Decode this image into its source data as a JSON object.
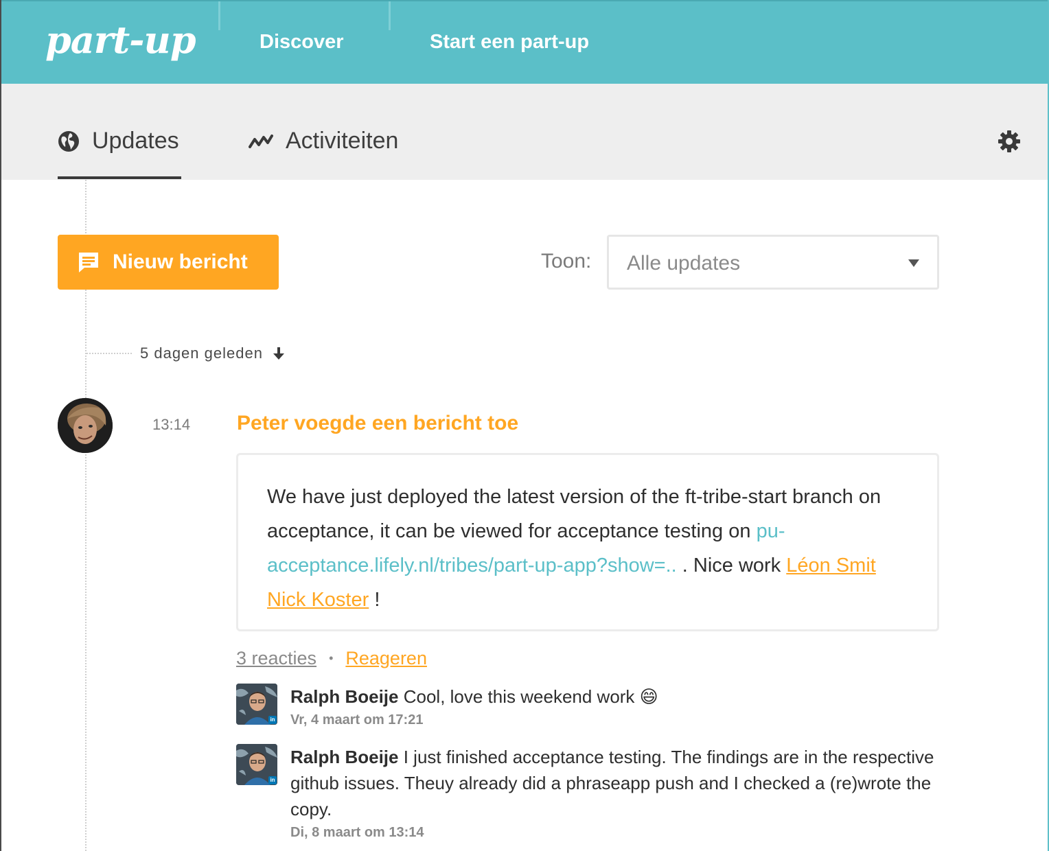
{
  "navbar": {
    "logo": "part-up",
    "links": [
      "Discover",
      "Start een part-up"
    ],
    "background": "#5bbfc8"
  },
  "tabs": {
    "updates": "Updates",
    "activities": "Activiteiten",
    "icons": {
      "updates": "globe-icon",
      "activities": "activity-icon",
      "settings": "gear-icon"
    }
  },
  "toolbar": {
    "new_message": "Nieuw bericht",
    "filter_label": "Toon:",
    "filter_value": "Alle updates",
    "accent": "#ffa622"
  },
  "timeline": {
    "date_label": "5 dagen geleden"
  },
  "post": {
    "time": "13:14",
    "title": "Peter voegde een bericht toe",
    "text_1": "We have just deployed the latest version of the ft-tribe-start branch on acceptance, it can be viewed for acceptance testing on",
    "link": "pu-acceptance.lifely.nl/tribes/part-up-app?show=..",
    "text_2": ". Nice work",
    "mention_1": "Léon Smit",
    "mention_2": "Nick Koster",
    "text_3": "!",
    "reactions": "3 reacties",
    "reply": "Reageren"
  },
  "comments": [
    {
      "author": "Ralph Boeije",
      "text": "Cool, love this weekend work 😄",
      "stamp": "Vr, 4 maart om 17:21"
    },
    {
      "author": "Ralph Boeije",
      "text": "I just finished acceptance testing. The findings are in the respective github issues. Theuy already did a phraseapp push and I checked a (re)wrote the copy.",
      "stamp": "Di, 8 maart om 13:14"
    }
  ]
}
